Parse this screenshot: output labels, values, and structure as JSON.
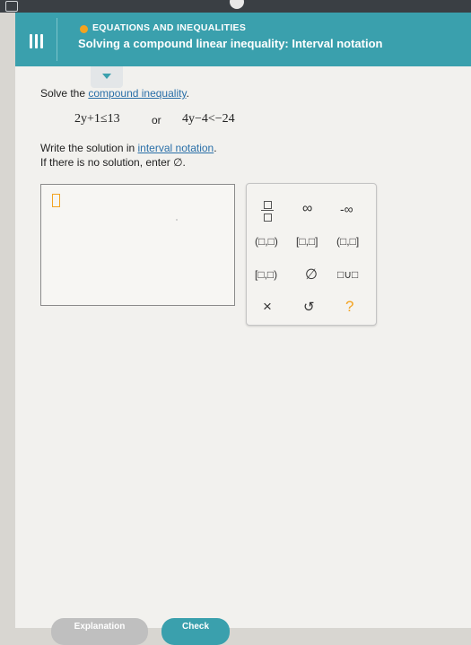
{
  "header": {
    "topic": "EQUATIONS AND INEQUALITIES",
    "title": "Solving a compound linear inequality: Interval notation"
  },
  "problem": {
    "intro_prefix": "Solve the ",
    "intro_link": "compound inequality",
    "intro_suffix": ".",
    "ineq1": "2y+1≤13",
    "connector": "or",
    "ineq2": "4y−4<−24",
    "instr_prefix": "Write the solution in ",
    "instr_link": "interval notation",
    "instr_suffix": ".",
    "empty_note": "If there is no solution, enter ∅."
  },
  "keypad": {
    "infinity": "∞",
    "neg_infinity": "-∞",
    "open_open": "(□,□)",
    "closed_closed": "[□,□]",
    "open_closed": "(□,□]",
    "closed_open": "[□,□)",
    "empty_set": "∅",
    "union": "□∪□",
    "clear": "×",
    "undo": "↺",
    "help": "?"
  },
  "buttons": {
    "explanation": "Explanation",
    "check": "Check"
  },
  "colors": {
    "header_bg": "#3aa0ad",
    "topic_dot": "#f3a321",
    "link": "#2a6fa8",
    "cursor": "#f3a321"
  }
}
